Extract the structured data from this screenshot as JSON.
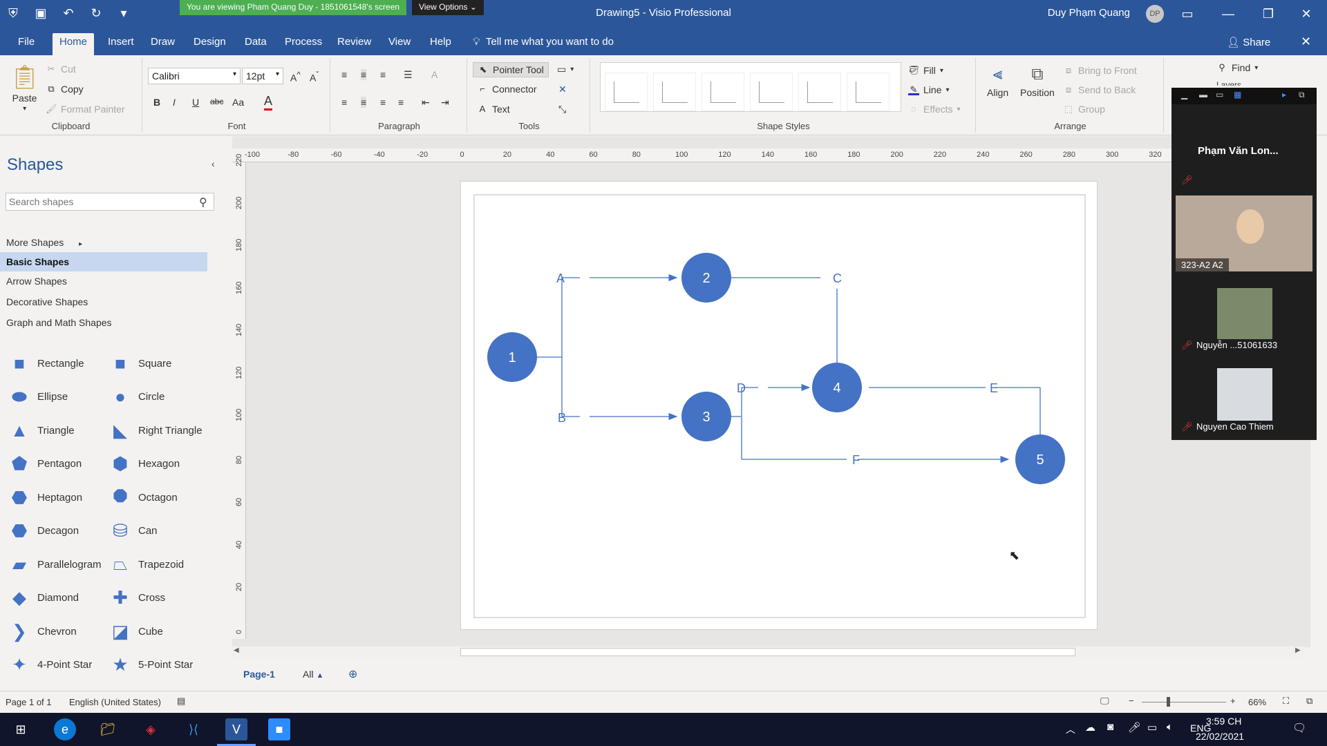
{
  "titlebar": {
    "share_banner": "You are viewing Pham Quang Duy - 1851061548's screen",
    "view_options": "View Options",
    "doc_title": "Drawing5  -  Visio Professional",
    "user_name": "Duy Phạm Quang",
    "avatar_initials": "DP"
  },
  "tabs": {
    "items": [
      "File",
      "Home",
      "Insert",
      "Draw",
      "Design",
      "Data",
      "Process",
      "Review",
      "View",
      "Help"
    ],
    "tell_me": "Tell me what you want to do",
    "share": "Share"
  },
  "ribbon": {
    "clipboard": {
      "paste": "Paste",
      "cut": "Cut",
      "copy": "Copy",
      "format_painter": "Format Painter",
      "label": "Clipboard"
    },
    "font": {
      "family": "Calibri",
      "size": "12pt",
      "label": "Font",
      "bold": "B",
      "italic": "I",
      "underline": "U",
      "strike": "abc",
      "case": "Aa",
      "color": "A"
    },
    "paragraph": {
      "label": "Paragraph"
    },
    "tools": {
      "pointer": "Pointer Tool",
      "connector": "Connector",
      "text": "Text",
      "label": "Tools"
    },
    "shape_styles": {
      "label": "Shape Styles",
      "fill": "Fill",
      "line": "Line",
      "effects": "Effects"
    },
    "arrange": {
      "align": "Align",
      "position": "Position",
      "bring_front": "Bring to Front",
      "send_back": "Send to Back",
      "group": "Group",
      "label": "Arrange"
    },
    "editing": {
      "find": "Find",
      "layers": "Layers"
    }
  },
  "shapes_pane": {
    "title": "Shapes",
    "search_placeholder": "Search shapes",
    "stencils": [
      "More Shapes",
      "Basic Shapes",
      "Arrow Shapes",
      "Decorative Shapes",
      "Graph and Math Shapes"
    ],
    "shapes": [
      "Rectangle",
      "Square",
      "Ellipse",
      "Circle",
      "Triangle",
      "Right Triangle",
      "Pentagon",
      "Hexagon",
      "Heptagon",
      "Octagon",
      "Decagon",
      "Can",
      "Parallelogram",
      "Trapezoid",
      "Diamond",
      "Cross",
      "Chevron",
      "Cube",
      "4-Point Star",
      "5-Point Star"
    ]
  },
  "rulers": {
    "top": [
      "-100",
      "-80",
      "-60",
      "-40",
      "-20",
      "0",
      "20",
      "40",
      "60",
      "80",
      "100",
      "120",
      "140",
      "160",
      "180",
      "200",
      "220",
      "240",
      "260",
      "280",
      "300",
      "320"
    ],
    "left": [
      "220",
      "200",
      "180",
      "160",
      "140",
      "120",
      "100",
      "80",
      "60",
      "40",
      "20",
      "0"
    ]
  },
  "diagram": {
    "node_color": "#4472c4",
    "edge_color": "#4472c4",
    "nodes": [
      "1",
      "2",
      "3",
      "4",
      "5"
    ],
    "edge_labels": [
      "A",
      "B",
      "C",
      "D",
      "E",
      "F"
    ]
  },
  "page_tabs": {
    "page": "Page-1",
    "all": "All"
  },
  "statusbar": {
    "page_info": "Page 1 of 1",
    "language": "English (United States)",
    "zoom": "66%"
  },
  "zoom_panel": {
    "participants": [
      "Phạm Văn Lon...",
      "323-A2 A2",
      "Nguyễn ...51061633",
      "Nguyen Cao Thiem"
    ]
  },
  "taskbar": {
    "time": "3:59 CH",
    "date": "22/02/2021",
    "lang": "ENG"
  }
}
